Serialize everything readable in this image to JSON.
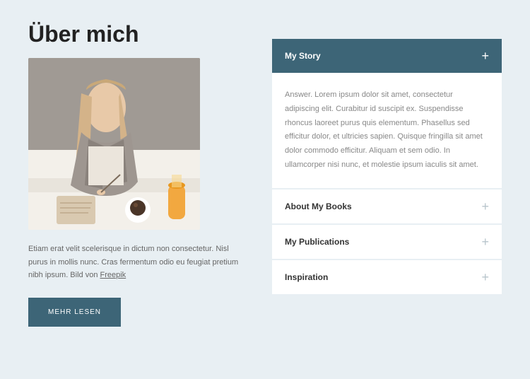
{
  "left": {
    "title": "Über mich",
    "description_before": "Etiam erat velit scelerisque in dictum non consectetur. Nisl purus in mollis nunc. Cras fermentum odio eu feugiat pretium nibh ipsum. Bild von ",
    "link_text": "Freepik",
    "button_label": "MEHR LESEN"
  },
  "accordion": [
    {
      "title": "My Story",
      "expanded": true,
      "body": "Answer. Lorem ipsum dolor sit amet, consectetur adipiscing elit. Curabitur id suscipit ex. Suspendisse rhoncus laoreet purus quis elementum. Phasellus sed efficitur dolor, et ultricies sapien. Quisque fringilla sit amet dolor commodo efficitur. Aliquam et sem odio. In ullamcorper nisi nunc, et molestie ipsum iaculis sit amet."
    },
    {
      "title": "About My Books",
      "expanded": false
    },
    {
      "title": "My Publications",
      "expanded": false
    },
    {
      "title": "Inspiration",
      "expanded": false
    }
  ]
}
